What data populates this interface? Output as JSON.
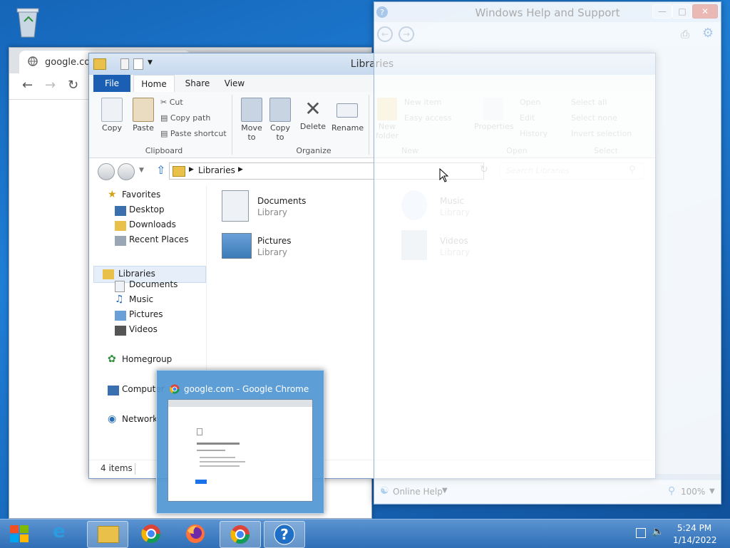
{
  "desktop": {
    "recycle_bin_icon": "recycle-bin-icon"
  },
  "chrome_window": {
    "tab_title": "google.com",
    "icons": [
      "back-icon",
      "forward-icon",
      "reload-icon"
    ]
  },
  "explorer": {
    "title": "Libraries",
    "ribbon_tabs": [
      "File",
      "Home",
      "Share",
      "View"
    ],
    "clipboard": {
      "copy": "Copy",
      "paste": "Paste",
      "cut": "Cut",
      "copy_path": "Copy path",
      "paste_shortcut": "Paste shortcut",
      "group": "Clipboard"
    },
    "organize": {
      "move_to": "Move to",
      "copy_to": "Copy to",
      "delete": "Delete",
      "rename": "Rename",
      "group": "Organize"
    },
    "new": {
      "new_folder": "New folder",
      "new_item": "New item",
      "easy_access": "Easy access",
      "group": "New"
    },
    "open": {
      "properties": "Properties",
      "open": "Open",
      "edit": "Edit",
      "history": "History",
      "group": "Open"
    },
    "select": {
      "select_all": "Select all",
      "select_none": "Select none",
      "invert": "Invert selection",
      "group": "Select"
    },
    "address_path": "Libraries",
    "search_placeholder": "Search Libraries",
    "nav": {
      "favorites": "Favorites",
      "desktop": "Desktop",
      "downloads": "Downloads",
      "recent": "Recent Places",
      "libraries": "Libraries",
      "documents": "Documents",
      "music": "Music",
      "pictures": "Pictures",
      "videos": "Videos",
      "homegroup": "Homegroup",
      "computer": "Computer",
      "network": "Network"
    },
    "items": [
      {
        "name": "Documents",
        "type": "Library"
      },
      {
        "name": "Music",
        "type": "Library"
      },
      {
        "name": "Pictures",
        "type": "Library"
      },
      {
        "name": "Videos",
        "type": "Library"
      }
    ],
    "status": "4 items"
  },
  "help_window": {
    "title": "Windows Help and Support",
    "online_help": "Online Help",
    "zoom": "100%"
  },
  "preview": {
    "title": "google.com - Google Chrome"
  },
  "taskbar": {
    "items": [
      "start-orb-icon",
      "internet-explorer-icon",
      "file-explorer-icon",
      "chrome-icon",
      "firefox-icon",
      "chrome-icon",
      "help-icon"
    ],
    "time": "5:24 PM",
    "date": "1/14/2022"
  },
  "colors": {
    "accent": "#1a5fb4",
    "taskbar": "#2f6fb6"
  }
}
